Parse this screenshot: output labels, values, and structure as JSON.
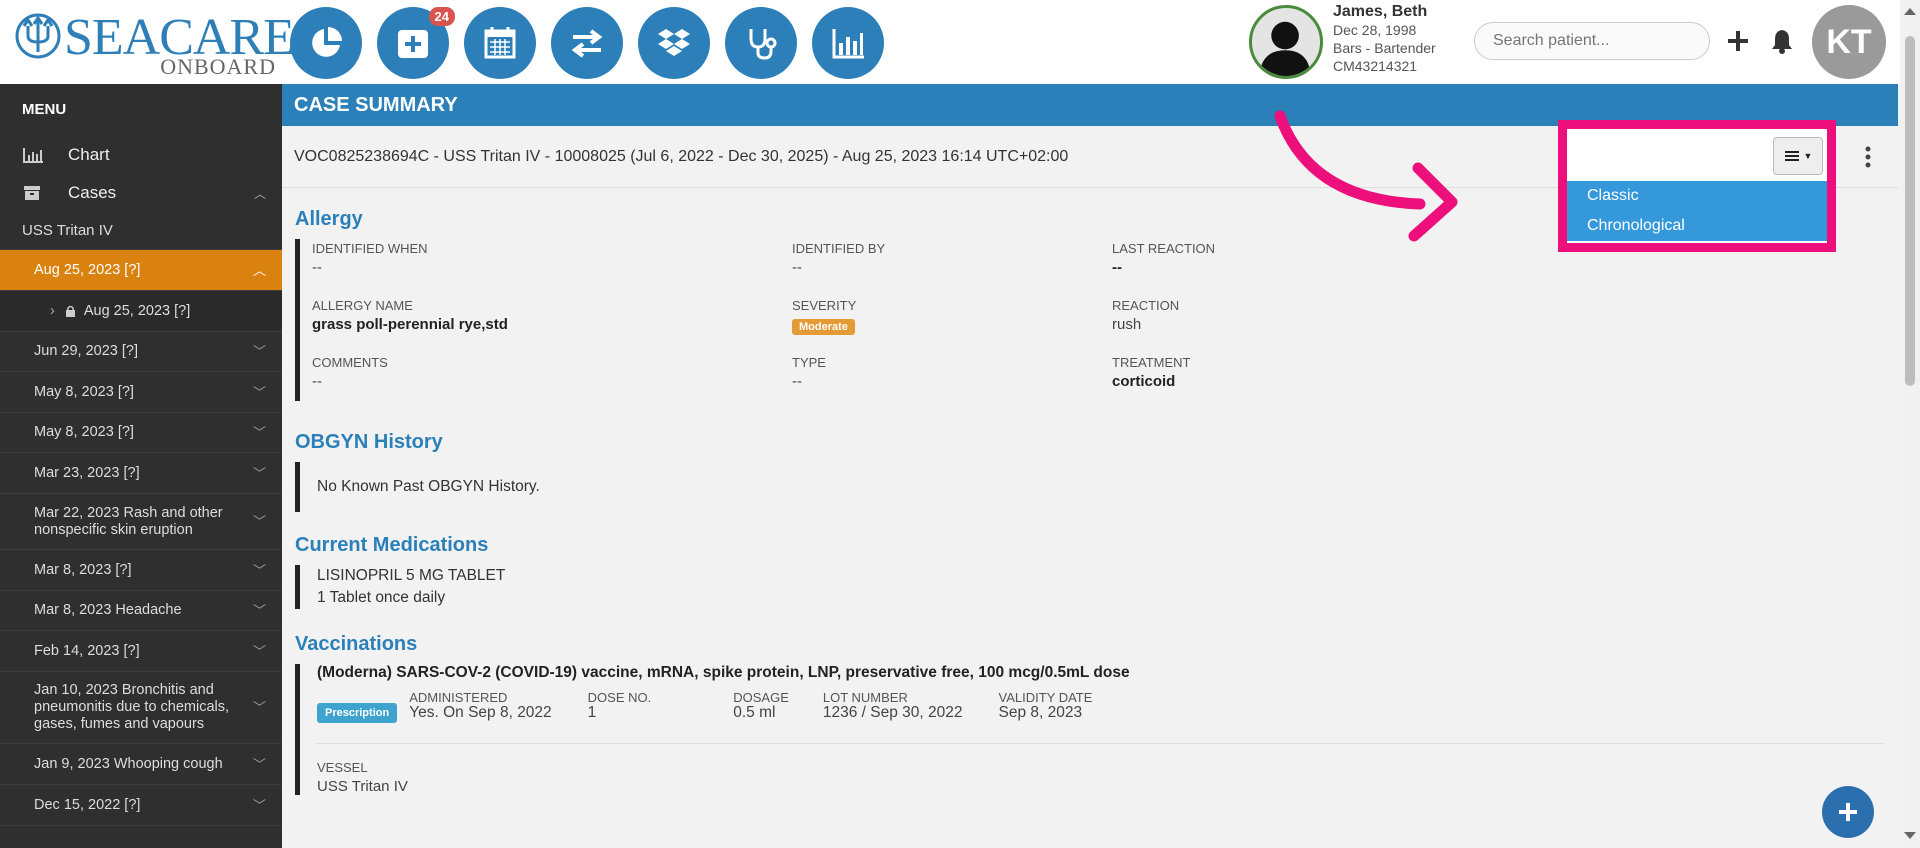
{
  "logo": {
    "main": "SEACARE",
    "sub": "ONBOARD"
  },
  "nav": {
    "badge_count": "24"
  },
  "patient": {
    "name": "James, Beth",
    "dob": "Dec 28, 1998",
    "role": "Bars - Bartender",
    "id": "CM43214321"
  },
  "search": {
    "placeholder": "Search patient..."
  },
  "user": {
    "initials": "KT"
  },
  "sidebar": {
    "menu_title": "MENU",
    "links": [
      {
        "label": "Chart"
      },
      {
        "label": "Cases"
      }
    ],
    "vessel": "USS Tritan IV",
    "cases": [
      {
        "label": "Aug 25, 2023 [?]"
      },
      {
        "label": "Aug 25, 2023 [?]"
      },
      {
        "label": "Jun 29, 2023 [?]"
      },
      {
        "label": "May 8, 2023 [?]"
      },
      {
        "label": "May 8, 2023 [?]"
      },
      {
        "label": "Mar 23, 2023 [?]"
      },
      {
        "label": "Mar 22, 2023 Rash and other nonspecific skin eruption"
      },
      {
        "label": "Mar 8, 2023 [?]"
      },
      {
        "label": "Mar 8, 2023 Headache"
      },
      {
        "label": "Feb 14, 2023 [?]"
      },
      {
        "label": "Jan 10, 2023 Bronchitis and pneumonitis due to chemicals, gases, fumes and vapours"
      },
      {
        "label": "Jan 9, 2023 Whooping cough"
      },
      {
        "label": "Dec 15, 2022 [?]"
      }
    ]
  },
  "main": {
    "header": "CASE SUMMARY",
    "case_title": "VOC0825238694C - USS Tritan IV - 10008025 (Jul 6, 2022 - Dec 30, 2025) - Aug 25, 2023 16:14 UTC+02:00",
    "view_menu": {
      "options": [
        {
          "label": "Classic"
        },
        {
          "label": "Chronological"
        }
      ]
    },
    "allergy": {
      "title": "Allergy",
      "identified_when_label": "IDENTIFIED WHEN",
      "identified_when": "--",
      "identified_by_label": "IDENTIFIED BY",
      "identified_by": "--",
      "last_reaction_label": "LAST REACTION",
      "last_reaction": "--",
      "name_label": "ALLERGY NAME",
      "name": "grass poll-perennial rye,std",
      "severity_label": "SEVERITY",
      "severity": "Moderate",
      "reaction_label": "REACTION",
      "reaction": "rush",
      "comments_label": "COMMENTS",
      "comments": "--",
      "type_label": "TYPE",
      "type": "--",
      "treatment_label": "TREATMENT",
      "treatment": "corticoid"
    },
    "obgyn": {
      "title": "OBGYN History",
      "text": "No Known Past OBGYN History."
    },
    "medications": {
      "title": "Current Medications",
      "name": "LISINOPRIL 5 MG TABLET",
      "dose": "1 Tablet once daily"
    },
    "vaccinations": {
      "title": "Vaccinations",
      "name": "(Moderna) SARS-COV-2 (COVID-19) vaccine, mRNA, spike protein, LNP, preservative free, 100 mcg/0.5mL dose",
      "tag": "Prescription",
      "administered_label": "ADMINISTERED",
      "administered": "Yes. On Sep 8, 2022",
      "dose_label": "DOSE NO.",
      "dose": "1",
      "dosage_label": "DOSAGE",
      "dosage": "0.5 ml",
      "lot_label": "LOT NUMBER",
      "lot": "1236 / Sep 30, 2022",
      "validity_label": "VALIDITY DATE",
      "validity": "Sep 8, 2023",
      "vessel_label": "VESSEL",
      "vessel": "USS Tritan IV"
    }
  },
  "colors": {
    "primary": "#2b80b9",
    "active_case": "#d9820f",
    "highlight": "#ec0f7c",
    "dropdown": "#3498db"
  }
}
